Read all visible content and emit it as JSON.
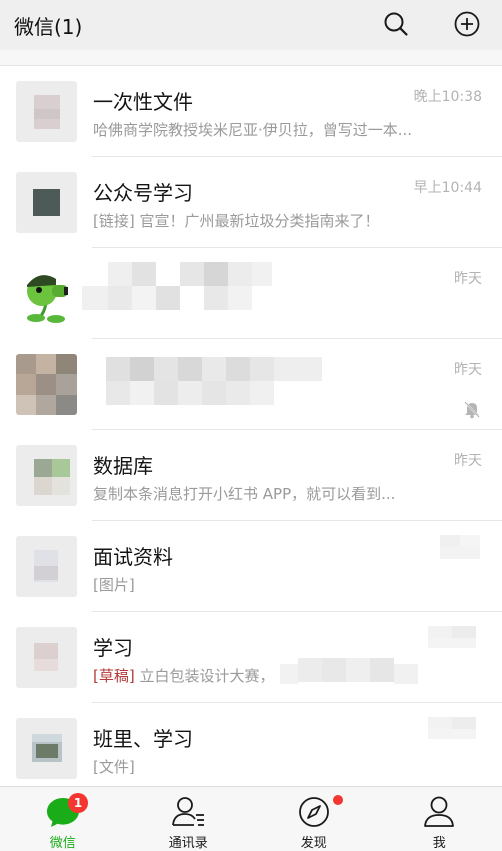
{
  "header": {
    "title": "微信(1)",
    "search_icon": "search-icon",
    "add_icon": "plus-circle-icon"
  },
  "chats": [
    {
      "name": "一次性文件",
      "preview": "哈佛商学院教授埃米尼亚·伊贝拉，曾写过一本...",
      "time": "晚上10:38"
    },
    {
      "name": "公众号学习",
      "preview": "[链接] 官宣！广州最新垃圾分类指南来了！",
      "time": "早上10:44"
    },
    {
      "name": "",
      "preview": "",
      "time": "昨天"
    },
    {
      "name": "",
      "preview": "",
      "time": "昨天",
      "muted": true
    },
    {
      "name": "数据库",
      "preview": "复制本条消息打开小红书 APP，就可以看到...",
      "time": "昨天"
    },
    {
      "name": "面试资料",
      "preview": "[图片]",
      "time": ""
    },
    {
      "name": "学习",
      "draft_tag": "[草稿]",
      "preview": " 立白包装设计大赛，",
      "time": ""
    },
    {
      "name": "班里、学习",
      "preview": "[文件]",
      "time": ""
    }
  ],
  "tabbar": {
    "tabs": [
      {
        "label": "微信",
        "icon": "chat-bubble-icon",
        "badge": "1",
        "active": true
      },
      {
        "label": "通讯录",
        "icon": "contacts-icon"
      },
      {
        "label": "发现",
        "icon": "compass-icon",
        "dot": true
      },
      {
        "label": "我",
        "icon": "person-icon"
      }
    ]
  },
  "colors": {
    "accent": "#1aad19",
    "badge": "#f43530",
    "draft": "#b43a3a"
  }
}
